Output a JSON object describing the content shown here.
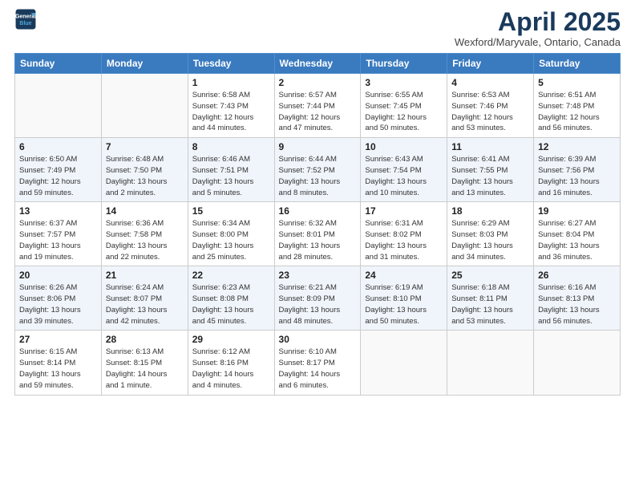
{
  "header": {
    "logo_line1": "General",
    "logo_line2": "Blue",
    "title": "April 2025",
    "subtitle": "Wexford/Maryvale, Ontario, Canada"
  },
  "weekdays": [
    "Sunday",
    "Monday",
    "Tuesday",
    "Wednesday",
    "Thursday",
    "Friday",
    "Saturday"
  ],
  "weeks": [
    [
      {
        "day": "",
        "info": ""
      },
      {
        "day": "",
        "info": ""
      },
      {
        "day": "1",
        "info": "Sunrise: 6:58 AM\nSunset: 7:43 PM\nDaylight: 12 hours\nand 44 minutes."
      },
      {
        "day": "2",
        "info": "Sunrise: 6:57 AM\nSunset: 7:44 PM\nDaylight: 12 hours\nand 47 minutes."
      },
      {
        "day": "3",
        "info": "Sunrise: 6:55 AM\nSunset: 7:45 PM\nDaylight: 12 hours\nand 50 minutes."
      },
      {
        "day": "4",
        "info": "Sunrise: 6:53 AM\nSunset: 7:46 PM\nDaylight: 12 hours\nand 53 minutes."
      },
      {
        "day": "5",
        "info": "Sunrise: 6:51 AM\nSunset: 7:48 PM\nDaylight: 12 hours\nand 56 minutes."
      }
    ],
    [
      {
        "day": "6",
        "info": "Sunrise: 6:50 AM\nSunset: 7:49 PM\nDaylight: 12 hours\nand 59 minutes."
      },
      {
        "day": "7",
        "info": "Sunrise: 6:48 AM\nSunset: 7:50 PM\nDaylight: 13 hours\nand 2 minutes."
      },
      {
        "day": "8",
        "info": "Sunrise: 6:46 AM\nSunset: 7:51 PM\nDaylight: 13 hours\nand 5 minutes."
      },
      {
        "day": "9",
        "info": "Sunrise: 6:44 AM\nSunset: 7:52 PM\nDaylight: 13 hours\nand 8 minutes."
      },
      {
        "day": "10",
        "info": "Sunrise: 6:43 AM\nSunset: 7:54 PM\nDaylight: 13 hours\nand 10 minutes."
      },
      {
        "day": "11",
        "info": "Sunrise: 6:41 AM\nSunset: 7:55 PM\nDaylight: 13 hours\nand 13 minutes."
      },
      {
        "day": "12",
        "info": "Sunrise: 6:39 AM\nSunset: 7:56 PM\nDaylight: 13 hours\nand 16 minutes."
      }
    ],
    [
      {
        "day": "13",
        "info": "Sunrise: 6:37 AM\nSunset: 7:57 PM\nDaylight: 13 hours\nand 19 minutes."
      },
      {
        "day": "14",
        "info": "Sunrise: 6:36 AM\nSunset: 7:58 PM\nDaylight: 13 hours\nand 22 minutes."
      },
      {
        "day": "15",
        "info": "Sunrise: 6:34 AM\nSunset: 8:00 PM\nDaylight: 13 hours\nand 25 minutes."
      },
      {
        "day": "16",
        "info": "Sunrise: 6:32 AM\nSunset: 8:01 PM\nDaylight: 13 hours\nand 28 minutes."
      },
      {
        "day": "17",
        "info": "Sunrise: 6:31 AM\nSunset: 8:02 PM\nDaylight: 13 hours\nand 31 minutes."
      },
      {
        "day": "18",
        "info": "Sunrise: 6:29 AM\nSunset: 8:03 PM\nDaylight: 13 hours\nand 34 minutes."
      },
      {
        "day": "19",
        "info": "Sunrise: 6:27 AM\nSunset: 8:04 PM\nDaylight: 13 hours\nand 36 minutes."
      }
    ],
    [
      {
        "day": "20",
        "info": "Sunrise: 6:26 AM\nSunset: 8:06 PM\nDaylight: 13 hours\nand 39 minutes."
      },
      {
        "day": "21",
        "info": "Sunrise: 6:24 AM\nSunset: 8:07 PM\nDaylight: 13 hours\nand 42 minutes."
      },
      {
        "day": "22",
        "info": "Sunrise: 6:23 AM\nSunset: 8:08 PM\nDaylight: 13 hours\nand 45 minutes."
      },
      {
        "day": "23",
        "info": "Sunrise: 6:21 AM\nSunset: 8:09 PM\nDaylight: 13 hours\nand 48 minutes."
      },
      {
        "day": "24",
        "info": "Sunrise: 6:19 AM\nSunset: 8:10 PM\nDaylight: 13 hours\nand 50 minutes."
      },
      {
        "day": "25",
        "info": "Sunrise: 6:18 AM\nSunset: 8:11 PM\nDaylight: 13 hours\nand 53 minutes."
      },
      {
        "day": "26",
        "info": "Sunrise: 6:16 AM\nSunset: 8:13 PM\nDaylight: 13 hours\nand 56 minutes."
      }
    ],
    [
      {
        "day": "27",
        "info": "Sunrise: 6:15 AM\nSunset: 8:14 PM\nDaylight: 13 hours\nand 59 minutes."
      },
      {
        "day": "28",
        "info": "Sunrise: 6:13 AM\nSunset: 8:15 PM\nDaylight: 14 hours\nand 1 minute."
      },
      {
        "day": "29",
        "info": "Sunrise: 6:12 AM\nSunset: 8:16 PM\nDaylight: 14 hours\nand 4 minutes."
      },
      {
        "day": "30",
        "info": "Sunrise: 6:10 AM\nSunset: 8:17 PM\nDaylight: 14 hours\nand 6 minutes."
      },
      {
        "day": "",
        "info": ""
      },
      {
        "day": "",
        "info": ""
      },
      {
        "day": "",
        "info": ""
      }
    ]
  ]
}
